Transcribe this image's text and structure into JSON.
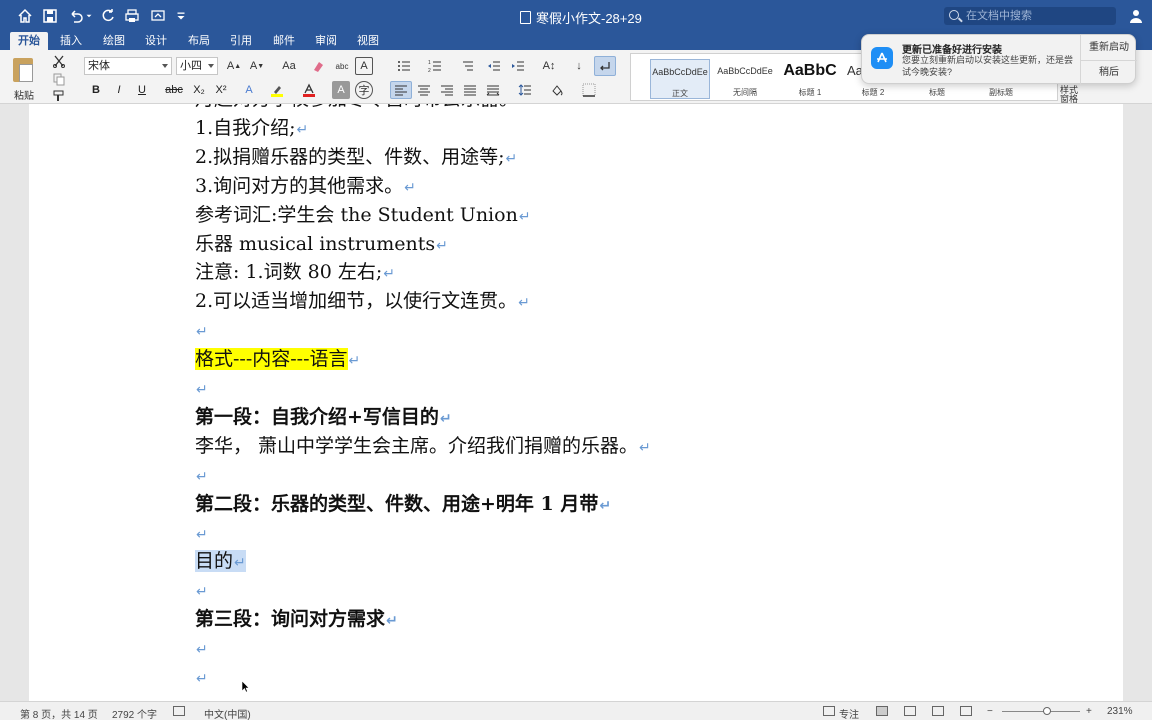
{
  "titlebar": {
    "doc_title": "寒假小作文-28+29",
    "search_placeholder": "在文档中搜索"
  },
  "tabs": [
    "开始",
    "插入",
    "绘图",
    "设计",
    "布局",
    "引用",
    "邮件",
    "审阅",
    "视图"
  ],
  "ribbon": {
    "paste_label": "粘贴",
    "font_name": "宋体",
    "font_size": "小四",
    "format_buttons": [
      "B",
      "I",
      "U",
      "abc",
      "X₂",
      "X²"
    ],
    "styles": [
      {
        "preview": "AaBbCcDdEe",
        "name": "正文"
      },
      {
        "preview": "AaBbCcDdEe",
        "name": "无间隔"
      },
      {
        "preview": "AaBbC",
        "name": "标题 1"
      },
      {
        "preview": "Aa",
        "name": "标题 2"
      },
      {
        "preview": "",
        "name": "标题"
      },
      {
        "preview": "",
        "name": "副标题"
      }
    ],
    "style_pane_label": "样式窗格"
  },
  "notification": {
    "title": "更新已准备好进行安装",
    "body": "您要立刻重新启动以安装这些更新，还是尝试今晚安装?",
    "restart_label": "重新启动",
    "later_label": "稍后"
  },
  "document": {
    "pilcrow": "↵",
    "lines": [
      {
        "text": "月起对方学校参加冬令营时带去乐器。",
        "style": "normal"
      },
      {
        "text": "1.自我介绍;",
        "style": "normal"
      },
      {
        "text": "2.拟捐赠乐器的类型、件数、用途等;",
        "style": "normal"
      },
      {
        "text": "3.询问对方的其他需求。",
        "style": "normal"
      },
      {
        "text": "参考词汇:学生会 the Student Union",
        "style": "normal"
      },
      {
        "text": "乐器 musical instruments",
        "style": "normal"
      },
      {
        "text": "注意: 1.词数 80 左右;",
        "style": "normal"
      },
      {
        "text": "2.可以适当增加细节，以使行文连贯。",
        "style": "normal"
      },
      {
        "text": "",
        "style": "normal"
      },
      {
        "text": "格式---内容---语言",
        "style": "highlight"
      },
      {
        "text": "",
        "style": "normal"
      },
      {
        "text": "第一段：自我介绍+写信目的",
        "style": "bold"
      },
      {
        "text": "李华， 萧山中学学生会主席。介绍我们捐赠的乐器。",
        "style": "normal"
      },
      {
        "text": "",
        "style": "normal"
      },
      {
        "text": "第二段：乐器的类型、件数、用途+明年 1 月带",
        "style": "bold"
      },
      {
        "text": "",
        "style": "normal"
      },
      {
        "text": "目的",
        "style": "selected"
      },
      {
        "text": "",
        "style": "normal"
      },
      {
        "text": "第三段：询问对方需求",
        "style": "bold"
      },
      {
        "text": "",
        "style": "normal"
      },
      {
        "text": "",
        "style": "normal"
      }
    ]
  },
  "statusbar": {
    "page": "第 8 页，共 14 页",
    "words": "2792 个字",
    "language": "中文(中国)",
    "focus": "专注",
    "zoom": "231%",
    "zoom_level": 0.58
  },
  "colors": {
    "brand": "#2b579a",
    "highlight": "#ffff00",
    "selection": "#c8dcf5",
    "pilcrow": "#6a9ad3"
  }
}
